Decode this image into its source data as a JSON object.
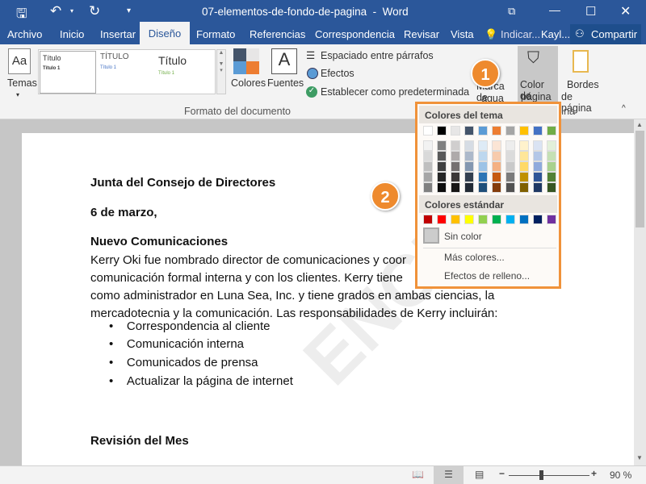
{
  "window": {
    "title": "07-elementos-de-fondo-de-pagina  -  Word",
    "controls": [
      "restore-ribbon",
      "minimize",
      "maximize",
      "close"
    ]
  },
  "tabs": [
    {
      "label": "Archivo"
    },
    {
      "label": "Inicio"
    },
    {
      "label": "Insertar"
    },
    {
      "label": "Diseño",
      "active": true
    },
    {
      "label": "Formato"
    },
    {
      "label": "Referencias"
    },
    {
      "label": "Correspondencia"
    },
    {
      "label": "Revisar"
    },
    {
      "label": "Vista"
    }
  ],
  "tell_me": "Indicar...",
  "user": "Kayl...",
  "share": "Compartir",
  "ribbon": {
    "temas": "Temas",
    "styles": [
      {
        "title": "Título",
        "sub": "Título 1"
      },
      {
        "title": "TÍTULO",
        "sub": "Título 1"
      },
      {
        "title": "Título",
        "sub": "Título 1"
      }
    ],
    "colores": "Colores",
    "fuentes": "Fuentes",
    "espaciado": "Espaciado entre párrafos",
    "efectos": "Efectos",
    "predeterminada": "Establecer como predeterminada",
    "group_label": "Formato del documento",
    "marca_agua": [
      "Marca de",
      "agua"
    ],
    "color_pagina": [
      "Color de",
      "página"
    ],
    "bordes": [
      "Bordes",
      "de página"
    ],
    "group2_label": "Fondo de página"
  },
  "dropdown": {
    "theme_header": "Colores del tema",
    "theme_top": [
      "#FFFFFF",
      "#000000",
      "#E7E6E6",
      "#44546A",
      "#5B9BD5",
      "#ED7D31",
      "#A5A5A5",
      "#FFC000",
      "#4472C4",
      "#70AD47"
    ],
    "theme_shades": [
      [
        "#F2F2F2",
        "#D9D9D9",
        "#BFBFBF",
        "#A6A6A6",
        "#808080"
      ],
      [
        "#808080",
        "#595959",
        "#404040",
        "#262626",
        "#0D0D0D"
      ],
      [
        "#D0CECE",
        "#AEAAAA",
        "#757171",
        "#3B3838",
        "#171616"
      ],
      [
        "#D6DCE4",
        "#ADB9CA",
        "#8497B0",
        "#333F4F",
        "#222A35"
      ],
      [
        "#DEEBF6",
        "#BDD7EE",
        "#9DC3E6",
        "#2E75B5",
        "#1F4E79"
      ],
      [
        "#FBE5D5",
        "#F7CBAC",
        "#F4B183",
        "#C55A11",
        "#843C0B"
      ],
      [
        "#EDEDED",
        "#DBDBDB",
        "#C9C9C9",
        "#7B7B7B",
        "#525252"
      ],
      [
        "#FFF2CC",
        "#FFE699",
        "#FFD966",
        "#BF9000",
        "#7F6000"
      ],
      [
        "#DAE3F3",
        "#B4C7E7",
        "#8FAADC",
        "#2F5597",
        "#1F3864"
      ],
      [
        "#E2F0D9",
        "#C5E0B4",
        "#A9D18E",
        "#538135",
        "#375623"
      ]
    ],
    "standard_header": "Colores estándar",
    "standard": [
      "#C00000",
      "#FF0000",
      "#FFC000",
      "#FFFF00",
      "#92D050",
      "#00B050",
      "#00B0F0",
      "#0070C0",
      "#002060",
      "#7030A0"
    ],
    "no_color": "Sin color",
    "more_colors": "Más colores...",
    "fill_effects": "Efectos de relleno..."
  },
  "callouts": [
    "1",
    "2"
  ],
  "document": {
    "heading": "Junta del Consejo de Directores",
    "date": "6 de marzo,",
    "section": "Nuevo Comunicaciones",
    "para": [
      "Kerry Oki fue nombrado director de comunicaciones y coor",
      "comunicación formal interna y con los clientes. Kerry tiene",
      "como administrador en Luna Sea, Inc. y tiene grados en ambas ciencias, la",
      "mercadotecnia y la comunicación. Las responsabilidades de Kerry incluirán:"
    ],
    "bullets": [
      "Correspondencia al cliente",
      "Comunicación interna",
      "Comunicados de prensa",
      "Actualizar la página de internet"
    ],
    "section2": "Revisión del Mes",
    "watermark": "ENCIAL"
  },
  "status": {
    "zoom": "90 %",
    "zoom_percent": 90
  },
  "colors": {
    "accent": "#2B579A",
    "callout": "#EE8A2E"
  }
}
